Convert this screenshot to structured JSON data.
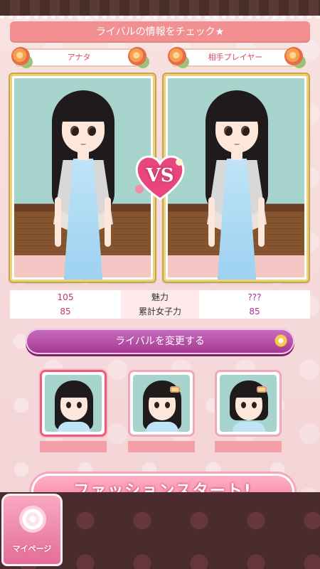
{
  "header": {
    "title": "ライバルの情報をチェック★"
  },
  "players": {
    "left_name": "アナタ",
    "right_name": "相手プレイヤー"
  },
  "vs": {
    "label": "VS"
  },
  "stats": [
    {
      "key": "魅力",
      "left": "105",
      "right": "???"
    },
    {
      "key": "累計女子力",
      "left": "85",
      "right": "85"
    }
  ],
  "change_rival": {
    "label": "ライバルを変更する"
  },
  "rivals": [
    {
      "selected": true,
      "name": ""
    },
    {
      "selected": false,
      "name": ""
    },
    {
      "selected": false,
      "name": ""
    }
  ],
  "start": {
    "label": "ファッションスタート!"
  },
  "nav": {
    "mypage_label": "マイページ"
  },
  "colors": {
    "title_bg": "#f28f91",
    "button_purple": "#a4368f",
    "accent_pink": "#f37da0",
    "nav_dark": "#4a2c2f"
  }
}
